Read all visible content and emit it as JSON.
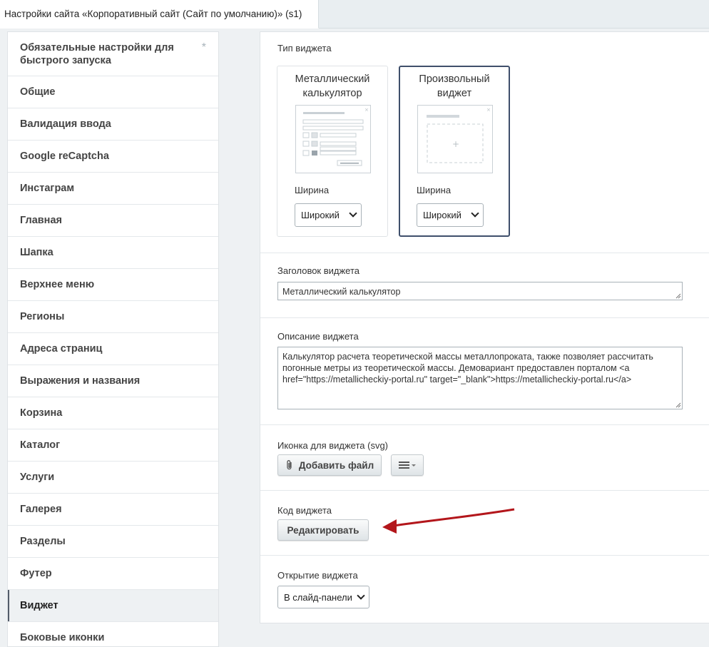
{
  "tab": {
    "title": "Настройки сайта «Корпоративный сайт (Сайт по умолчанию)» (s1)"
  },
  "sidebar": {
    "items": [
      {
        "label": "Обязательные настройки для быстрого запуска",
        "marker": "*"
      },
      {
        "label": "Общие"
      },
      {
        "label": "Валидация ввода"
      },
      {
        "label": "Google reCaptcha"
      },
      {
        "label": "Инстаграм"
      },
      {
        "label": "Главная"
      },
      {
        "label": "Шапка"
      },
      {
        "label": "Верхнее меню"
      },
      {
        "label": "Регионы"
      },
      {
        "label": "Адреса страниц"
      },
      {
        "label": "Выражения и названия"
      },
      {
        "label": "Корзина"
      },
      {
        "label": "Каталог"
      },
      {
        "label": "Услуги"
      },
      {
        "label": "Галерея"
      },
      {
        "label": "Разделы"
      },
      {
        "label": "Футер"
      },
      {
        "label": "Виджет",
        "active": true
      },
      {
        "label": "Боковые иконки"
      }
    ]
  },
  "widget_type": {
    "label": "Тип виджета",
    "cards": [
      {
        "title": "Металлический калькулятор",
        "width_label": "Ширина",
        "width_value": "Широкий",
        "selected": false
      },
      {
        "title": "Произвольный виджет",
        "width_label": "Ширина",
        "width_value": "Широкий",
        "selected": true
      }
    ]
  },
  "widget_title": {
    "label": "Заголовок виджета",
    "value": "Металлический калькулятор"
  },
  "widget_description": {
    "label": "Описание виджета",
    "value": "Калькулятор расчета теоретической массы металлопроката, также позволяет рассчитать погонные метры из теоретической массы. Демовариант предоставлен порталом <a href=\"https://metallicheckiy-portal.ru\" target=\"_blank\">https://metallicheckiy-portal.ru</a>"
  },
  "widget_icon": {
    "label": "Иконка для виджета (svg)",
    "add_file_label": "Добавить файл",
    "menu_icon": "hamburger-icon"
  },
  "widget_code": {
    "label": "Код виджета",
    "edit_label": "Редактировать"
  },
  "widget_open": {
    "label": "Открытие виджета",
    "value": "В слайд-панели"
  },
  "colors": {
    "arrow": "#b3161b",
    "selected_border": "#3f4f6b",
    "active_marker": "#535c69"
  }
}
